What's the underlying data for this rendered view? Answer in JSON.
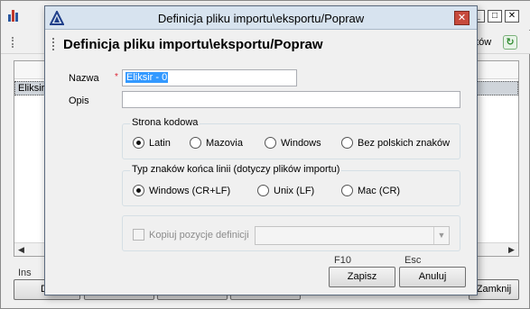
{
  "background": {
    "toolbar_text": "atów",
    "list_row": "Eliksir",
    "status": "Ins",
    "buttons": [
      "Do",
      "Zamknij"
    ]
  },
  "dialog": {
    "title": "Definicja pliku importu\\eksportu/Popraw",
    "heading": "Definicja pliku importu\\eksportu/Popraw",
    "close_glyph": "✕",
    "name_label": "Nazwa",
    "required_mark": "*",
    "name_value": "Eliksir - 0",
    "desc_label": "Opis",
    "desc_value": "",
    "codepage": {
      "title": "Strona kodowa",
      "options": [
        "Latin",
        "Mazovia",
        "Windows",
        "Bez polskich znaków"
      ],
      "selected": 0
    },
    "line_end": {
      "title": "Typ znaków końca linii (dotyczy plików importu)",
      "options": [
        "Windows (CR+LF)",
        "Unix (LF)",
        "Mac (CR)"
      ],
      "selected": 0
    },
    "copy_checkbox_label": "Kopiuj pozycje definicji",
    "copy_checked": false,
    "copy_combo_value": "",
    "save_key": "F10",
    "save_label": "Zapisz",
    "cancel_key": "Esc",
    "cancel_label": "Anuluj"
  }
}
